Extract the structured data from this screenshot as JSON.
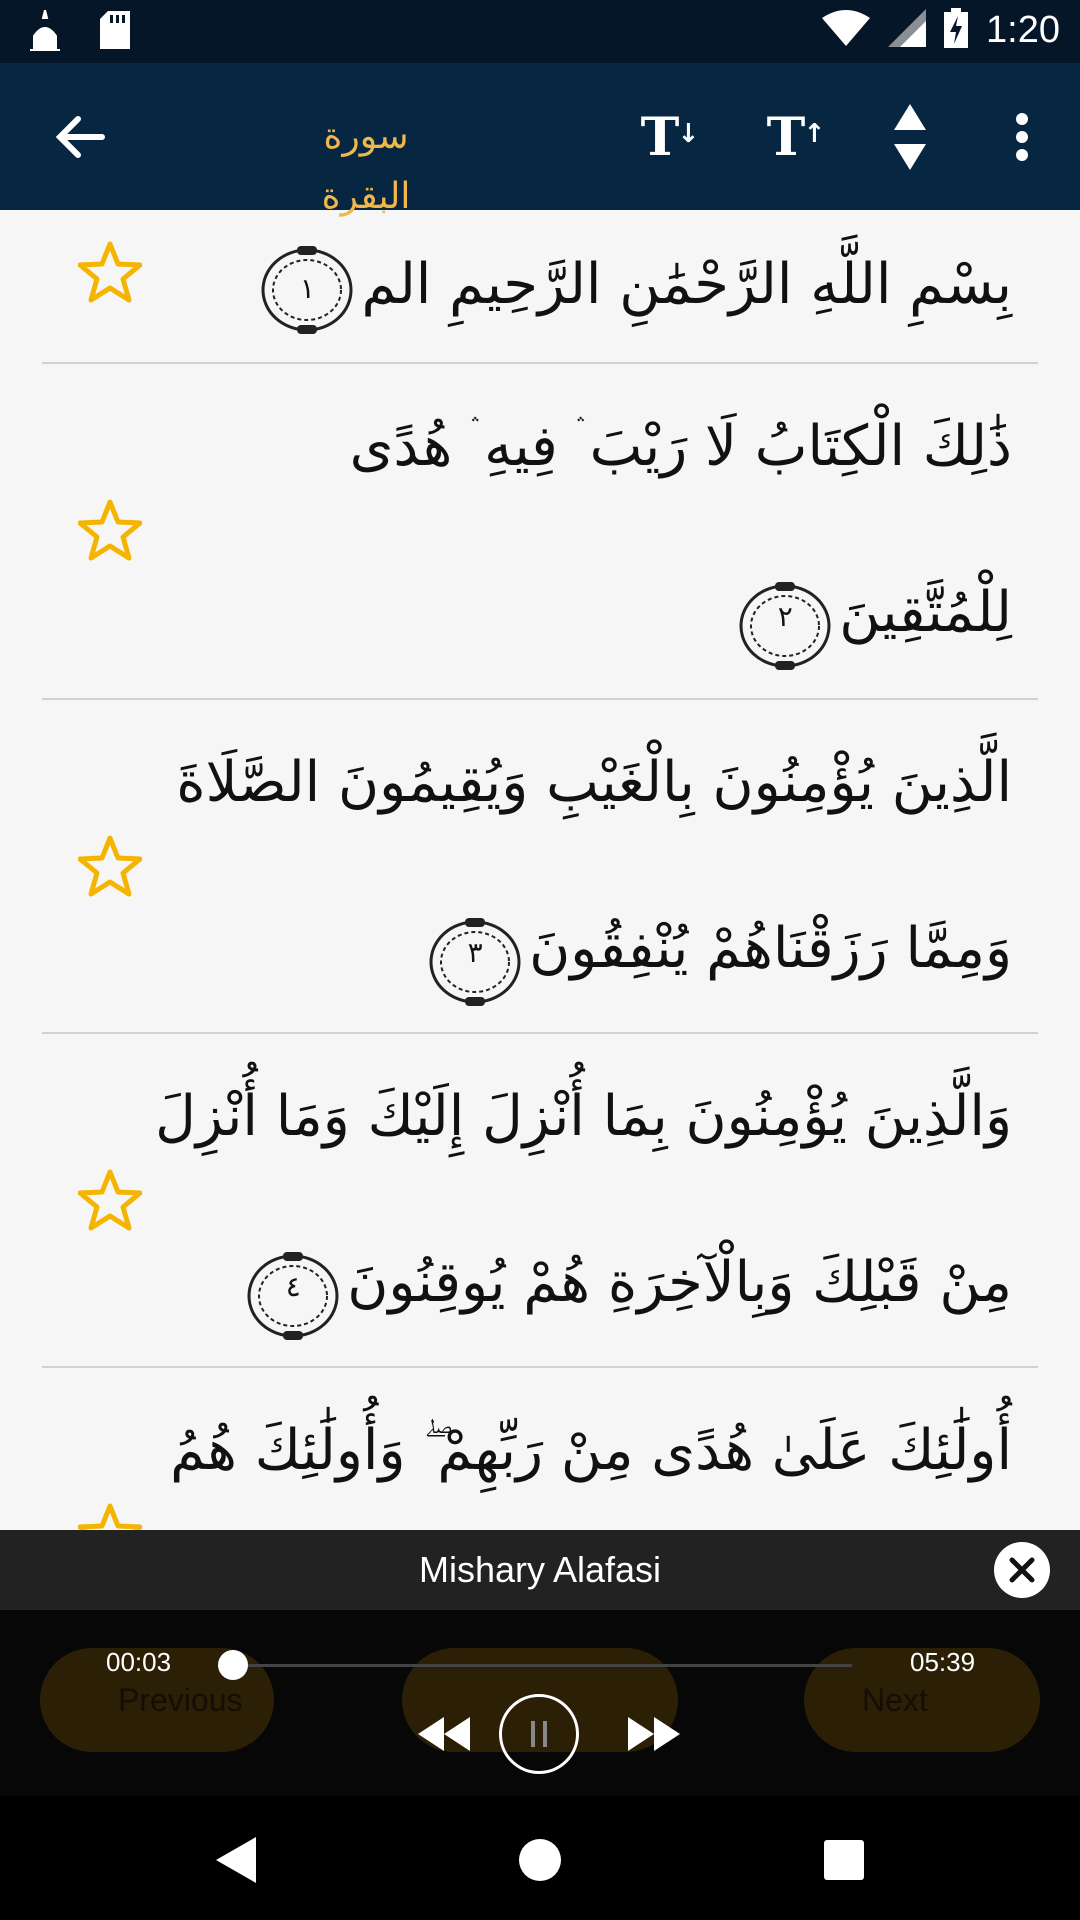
{
  "status_bar": {
    "time": "1:20",
    "icons": [
      "mosque-icon",
      "sd-card-icon",
      "wifi-icon",
      "signal-icon",
      "battery-charging-icon"
    ]
  },
  "app_bar": {
    "title": "سورة البقرة",
    "title_color": "#f0b84a",
    "background": "#072642",
    "actions": [
      "back-arrow-icon",
      "font-decrease-icon",
      "font-increase-icon",
      "scroll-toggle-icon",
      "more-vert-icon"
    ]
  },
  "verses": [
    {
      "number": "١",
      "lines": [
        "بِسْمِ اللَّهِ الرَّحْمَٰنِ الرَّحِيمِ الم"
      ],
      "bookmarked": false
    },
    {
      "number": "٢",
      "lines": [
        "ذَٰلِكَ الْكِتَابُ لَا رَيْبَ ۛ فِيهِ ۛ هُدًى",
        "لِلْمُتَّقِينَ"
      ],
      "bookmarked": false
    },
    {
      "number": "٣",
      "lines": [
        "الَّذِينَ يُؤْمِنُونَ بِالْغَيْبِ وَيُقِيمُونَ الصَّلَاةَ",
        "وَمِمَّا رَزَقْنَاهُمْ يُنْفِقُونَ"
      ],
      "bookmarked": false
    },
    {
      "number": "٤",
      "lines": [
        "وَالَّذِينَ يُؤْمِنُونَ بِمَا أُنْزِلَ إِلَيْكَ وَمَا أُنْزِلَ",
        "مِنْ قَبْلِكَ وَبِالْآخِرَةِ هُمْ يُوقِنُونَ"
      ],
      "bookmarked": false
    },
    {
      "number": "",
      "lines": [
        "أُولَٰئِكَ عَلَىٰ هُدًى مِنْ رَبِّهِمْ ۖ وَأُولَٰئِكَ هُمُ"
      ],
      "bookmarked": false
    }
  ],
  "accent_star_color": "#f5b400",
  "player": {
    "reciter": "Mishary Alafasi",
    "elapsed": "00:03",
    "duration": "05:39",
    "progress": 0.0089,
    "state": "playing",
    "prev_label": "Previous",
    "next_label": "Next"
  },
  "nav_bar": [
    "back-triangle-icon",
    "home-circle-icon",
    "recents-square-icon"
  ]
}
